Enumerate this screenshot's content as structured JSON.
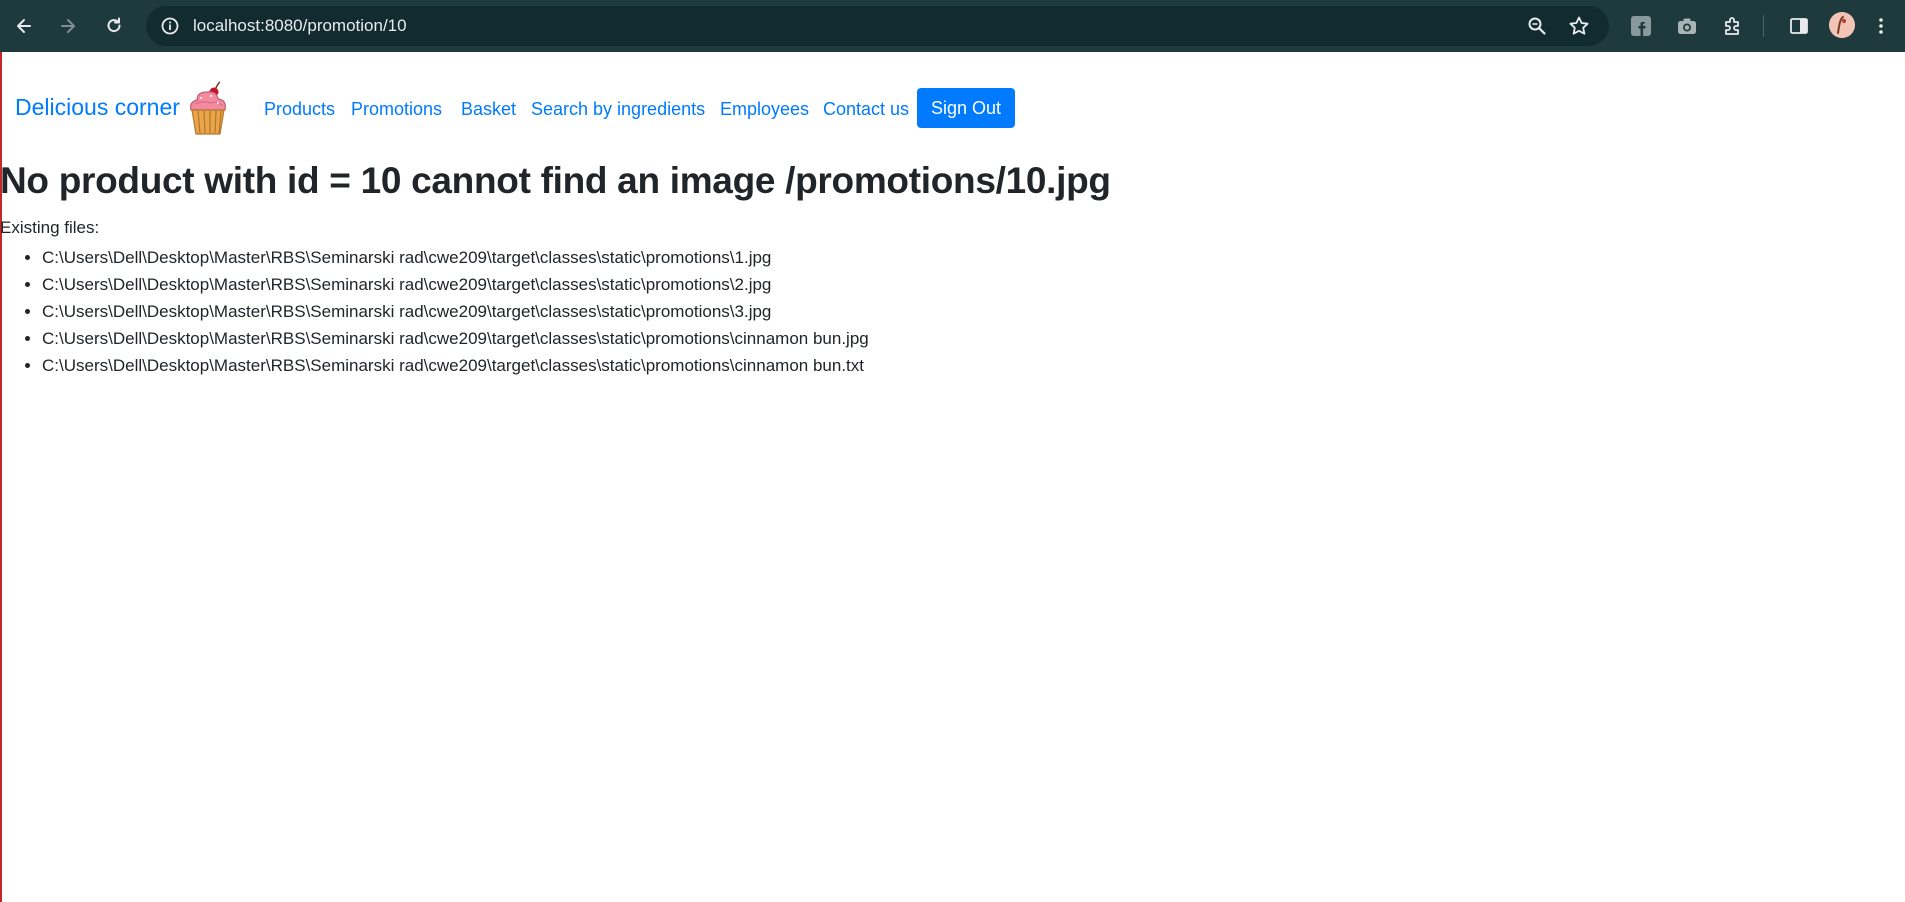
{
  "browser": {
    "url": "localhost:8080/promotion/10",
    "icons": {
      "back": "arrow-left-icon",
      "forward": "arrow-right-icon",
      "reload": "reload-icon",
      "site_info": "info-icon",
      "zoom": "zoom-icon",
      "bookmark": "star-icon",
      "extensions": [
        "facebook-icon",
        "camera-icon",
        "puzzle-icon"
      ],
      "side_panel": "side-panel-icon",
      "menu": "more-vert-icon"
    }
  },
  "navbar": {
    "brand": "Delicious corner",
    "brand_logo": "cupcake-icon",
    "links": [
      "Products",
      "Promotions",
      "Basket",
      "Search by ingredients",
      "Employees",
      "Contact us"
    ],
    "sign_out": "Sign Out"
  },
  "main": {
    "title": "No product with id = 10 cannot find an image /promotions/10.jpg",
    "existing_label": "Existing files:",
    "files": [
      "C:\\Users\\Dell\\Desktop\\Master\\RBS\\Seminarski rad\\cwe209\\target\\classes\\static\\promotions\\1.jpg",
      "C:\\Users\\Dell\\Desktop\\Master\\RBS\\Seminarski rad\\cwe209\\target\\classes\\static\\promotions\\2.jpg",
      "C:\\Users\\Dell\\Desktop\\Master\\RBS\\Seminarski rad\\cwe209\\target\\classes\\static\\promotions\\3.jpg",
      "C:\\Users\\Dell\\Desktop\\Master\\RBS\\Seminarski rad\\cwe209\\target\\classes\\static\\promotions\\cinnamon bun.jpg",
      "C:\\Users\\Dell\\Desktop\\Master\\RBS\\Seminarski rad\\cwe209\\target\\classes\\static\\promotions\\cinnamon bun.txt"
    ]
  },
  "colors": {
    "chrome_bg": "#1e3a3d",
    "omnibox_bg": "#122b2e",
    "link": "#007bff",
    "button_bg": "#007bff",
    "text": "#212529"
  }
}
